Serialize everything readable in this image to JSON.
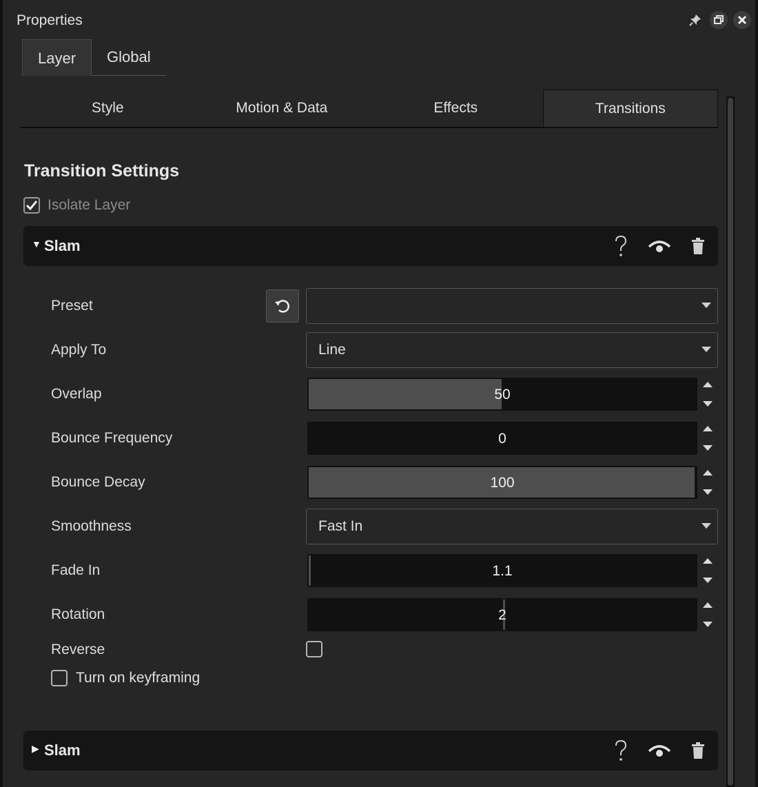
{
  "window": {
    "title": "Properties"
  },
  "title_icons": [
    "pin-icon",
    "restore-icon",
    "close-icon"
  ],
  "top_tabs": [
    {
      "label": "Layer",
      "active": true
    },
    {
      "label": "Global",
      "active": false
    }
  ],
  "sub_tabs": [
    {
      "label": "Style",
      "active": false
    },
    {
      "label": "Motion & Data",
      "active": false
    },
    {
      "label": "Effects",
      "active": false
    },
    {
      "label": "Transitions",
      "active": true
    }
  ],
  "section": {
    "title": "Transition Settings",
    "isolate_layer": {
      "label": "Isolate Layer",
      "checked": true
    }
  },
  "transitions": [
    {
      "name": "Slam",
      "expanded": true,
      "fields": {
        "preset": {
          "label": "Preset",
          "value": ""
        },
        "apply_to": {
          "label": "Apply To",
          "value": "Line"
        },
        "overlap": {
          "label": "Overlap",
          "value": "50",
          "fill": 0.5
        },
        "bounce_frequency": {
          "label": "Bounce Frequency",
          "value": "0",
          "fill": 0
        },
        "bounce_decay": {
          "label": "Bounce Decay",
          "value": "100",
          "fill": 1
        },
        "smoothness": {
          "label": "Smoothness",
          "value": "Fast In"
        },
        "fade_in": {
          "label": "Fade In",
          "value": "1.1"
        },
        "rotation": {
          "label": "Rotation",
          "value": "2"
        },
        "reverse": {
          "label": "Reverse",
          "checked": false
        },
        "keyframing": {
          "label": "Turn on keyframing",
          "checked": false
        }
      }
    },
    {
      "name": "Slam",
      "expanded": false
    }
  ]
}
